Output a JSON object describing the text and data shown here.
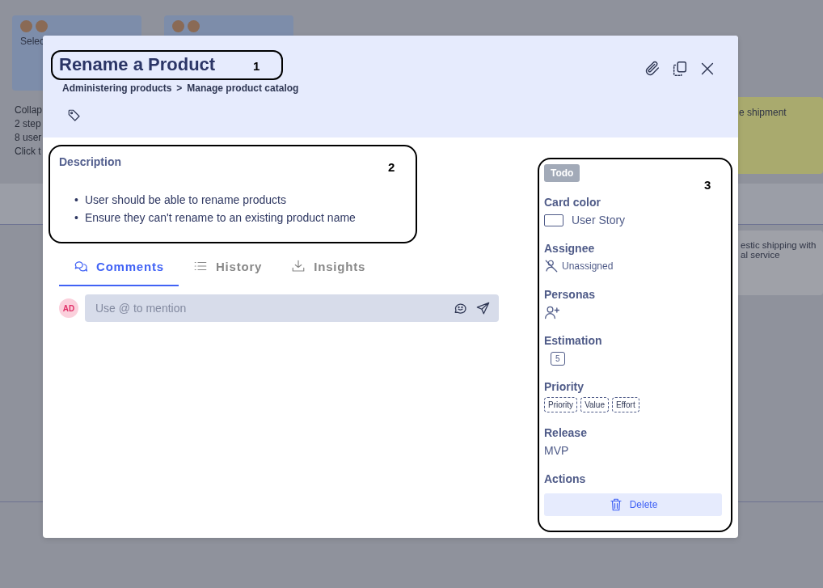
{
  "board": {
    "cards": [
      {
        "kind": "story",
        "text": "Selec"
      },
      {
        "kind": "story"
      },
      {
        "kind": "note",
        "lines": [
          "Collap",
          "2 step",
          "8 user",
          "Click t"
        ]
      },
      {
        "kind": "yellow",
        "text": "e shipment"
      },
      {
        "kind": "plain",
        "text": "estic shipping with\nal service"
      }
    ]
  },
  "dialog": {
    "title": "Rename a Product",
    "breadcrumb": [
      "Administering products",
      "Manage product catalog"
    ],
    "separator": ">",
    "description": {
      "heading": "Description",
      "bullets": [
        {
          "marker": "•",
          "text": "User should be able to rename products"
        },
        {
          "marker": "•",
          "text": "Ensure they can't rename to an existing product name"
        }
      ]
    },
    "tabs": [
      {
        "label": "Comments",
        "selected": true
      },
      {
        "label": "History",
        "selected": false
      },
      {
        "label": "Insights",
        "selected": false
      }
    ],
    "comment": {
      "avatar": "AD",
      "placeholder": "Use @ to mention"
    },
    "sidebar": {
      "status": "Todo",
      "sections": [
        {
          "kind": "color",
          "heading": "Card color",
          "value": "User Story"
        },
        {
          "kind": "assignee",
          "heading": "Assignee",
          "value": "Unassigned"
        },
        {
          "kind": "personas",
          "heading": "Personas"
        },
        {
          "kind": "estimation",
          "heading": "Estimation",
          "value": "5"
        },
        {
          "kind": "chips",
          "heading": "Priority",
          "chips": [
            "Priority",
            "Value",
            "Effort"
          ]
        },
        {
          "kind": "text",
          "heading": "Release",
          "value": "MVP"
        },
        {
          "kind": "action",
          "heading": "Actions",
          "value": "Delete"
        }
      ]
    }
  },
  "annotations": [
    {
      "label": "1"
    },
    {
      "label": "2"
    },
    {
      "label": "3"
    }
  ]
}
